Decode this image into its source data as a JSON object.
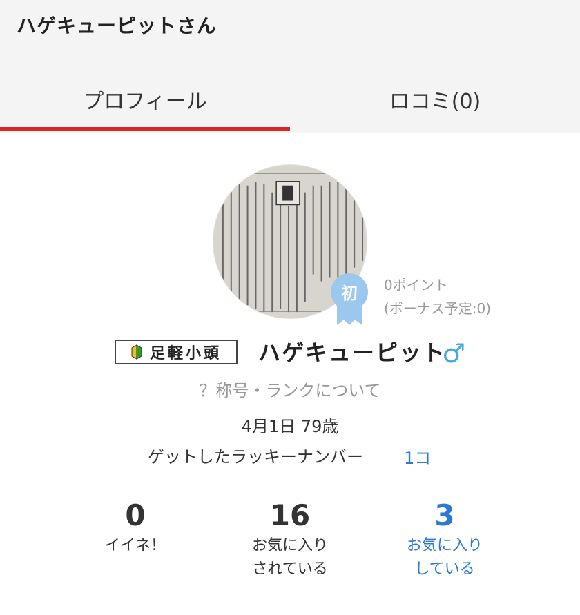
{
  "header": {
    "title": "ハゲキューピットさん",
    "tabs": [
      {
        "label": "プロフィール",
        "active": true
      },
      {
        "label": "ロコミ(0)",
        "active": false
      }
    ],
    "active_color": "#d7262c"
  },
  "profile": {
    "avatar_icon": "avatar-dictionary-photo",
    "first_badge": "初",
    "points": "0ポイント",
    "bonus": "(ボーナス予定:0)",
    "rank": "足軽小頭",
    "username": "ハゲキューピット",
    "gender_symbol": "♂",
    "title_link": "？称号・ランクについて",
    "birthday": "4月1日 79歳",
    "lucky_label": "ゲットしたラッキーナンバー",
    "lucky_count": "1コ"
  },
  "stats": [
    {
      "value": "0",
      "label_line1": "イイネ！",
      "label_line2": ""
    },
    {
      "value": "16",
      "label_line1": "お気に入り",
      "label_line2": "されている"
    },
    {
      "value": "3",
      "label_line1": "お気に入り",
      "label_line2": "している"
    }
  ],
  "colors": {
    "link": "#2a79d3",
    "badge_blue": "#9cc8ee",
    "gender": "#4aa8e0"
  }
}
